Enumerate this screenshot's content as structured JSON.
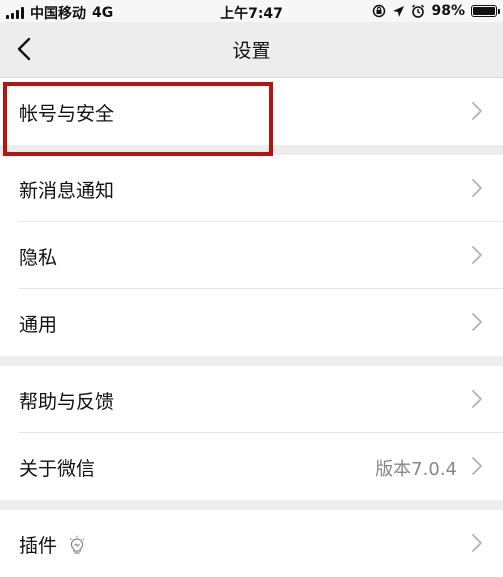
{
  "status_bar": {
    "carrier": "中国移动",
    "network": "4G",
    "time": "上午7:47",
    "battery_percent": "98%",
    "battery_level": 0.98
  },
  "nav": {
    "title": "设置"
  },
  "sections": [
    {
      "items": [
        {
          "label": "帐号与安全"
        }
      ]
    },
    {
      "items": [
        {
          "label": "新消息通知"
        },
        {
          "label": "隐私"
        },
        {
          "label": "通用"
        }
      ]
    },
    {
      "items": [
        {
          "label": "帮助与反馈"
        },
        {
          "label": "关于微信",
          "value": "版本7.0.4"
        }
      ]
    },
    {
      "items": [
        {
          "label": "插件"
        }
      ]
    }
  ],
  "colors": {
    "highlight": "#b5150e",
    "background": "#ededed",
    "row": "#ffffff"
  }
}
